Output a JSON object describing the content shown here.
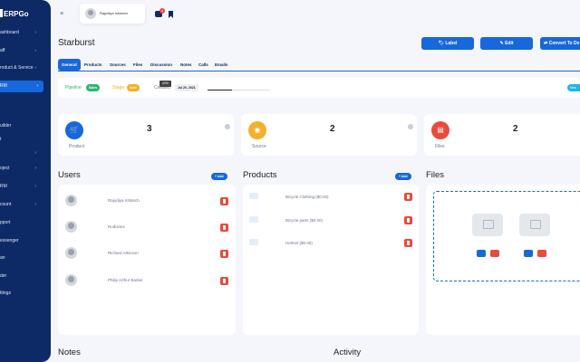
{
  "sidebar": {
    "brand": "ERPGo",
    "items": [
      {
        "label": "ashboard",
        "caret": "›"
      },
      {
        "label": "aff",
        "caret": "›"
      },
      {
        "label": "roduct & Service",
        "caret": "›"
      },
      {
        "label": "RM",
        "caret": "›"
      },
      {
        "label": "uilder",
        "caret": ""
      },
      {
        "label": "t",
        "caret": ""
      },
      {
        "label": "",
        "caret": "›"
      },
      {
        "label": "oject",
        "caret": "›"
      },
      {
        "label": "RM",
        "caret": "›"
      },
      {
        "label": "count",
        "caret": "›"
      },
      {
        "label": "pport",
        "caret": ""
      },
      {
        "label": "essenger",
        "caret": ""
      },
      {
        "label": "an",
        "caret": ""
      },
      {
        "label": "der",
        "caret": ""
      },
      {
        "label": "ttings",
        "caret": ""
      }
    ]
  },
  "topbar": {
    "menu_icon": "≡",
    "user_name": "Rajodiya Infotech",
    "chat_badge": "3"
  },
  "page": {
    "title": "Starburst",
    "buttons": [
      {
        "label": "🏷 Label"
      },
      {
        "label": "✎ Edit"
      },
      {
        "label": "⇄ Convert To De"
      }
    ]
  },
  "tabs": [
    "General",
    "Products",
    "Sources",
    "Files",
    "Discussion",
    "Notes",
    "Calls",
    "Emails"
  ],
  "status": {
    "pipeline_label": "Pipeline",
    "pipeline_value": "Sales",
    "stage_label": "Stage",
    "stage_value": "Sent",
    "created_label": "Created",
    "created_date": "Jul 20, 2021",
    "progress_label": "40%",
    "progress_value": 40,
    "new_label": "New"
  },
  "stats": [
    {
      "label": "Product",
      "value": "3",
      "icon": "🛒",
      "color": "#1767dd"
    },
    {
      "label": "Source",
      "value": "2",
      "icon": "◉",
      "color": "#f4b02a"
    },
    {
      "label": "Files",
      "value": "2",
      "icon": "▤",
      "color": "#e84b3c"
    }
  ],
  "users": {
    "title": "Users",
    "add_label": "+ Add",
    "rows": [
      "Rajodiya Infotech",
      "Rodisnex",
      "Richard Atkinson",
      "Philip Arthur Barker"
    ]
  },
  "products": {
    "title": "Products",
    "add_label": "+ Add",
    "rows": [
      "Bicycle Clothing ($0.00)",
      "Bicycle parts ($0.00)",
      "Helmet ($0.00)"
    ]
  },
  "files": {
    "title": "Files"
  },
  "footer": {
    "notes": "Notes",
    "activity": "Activity"
  }
}
